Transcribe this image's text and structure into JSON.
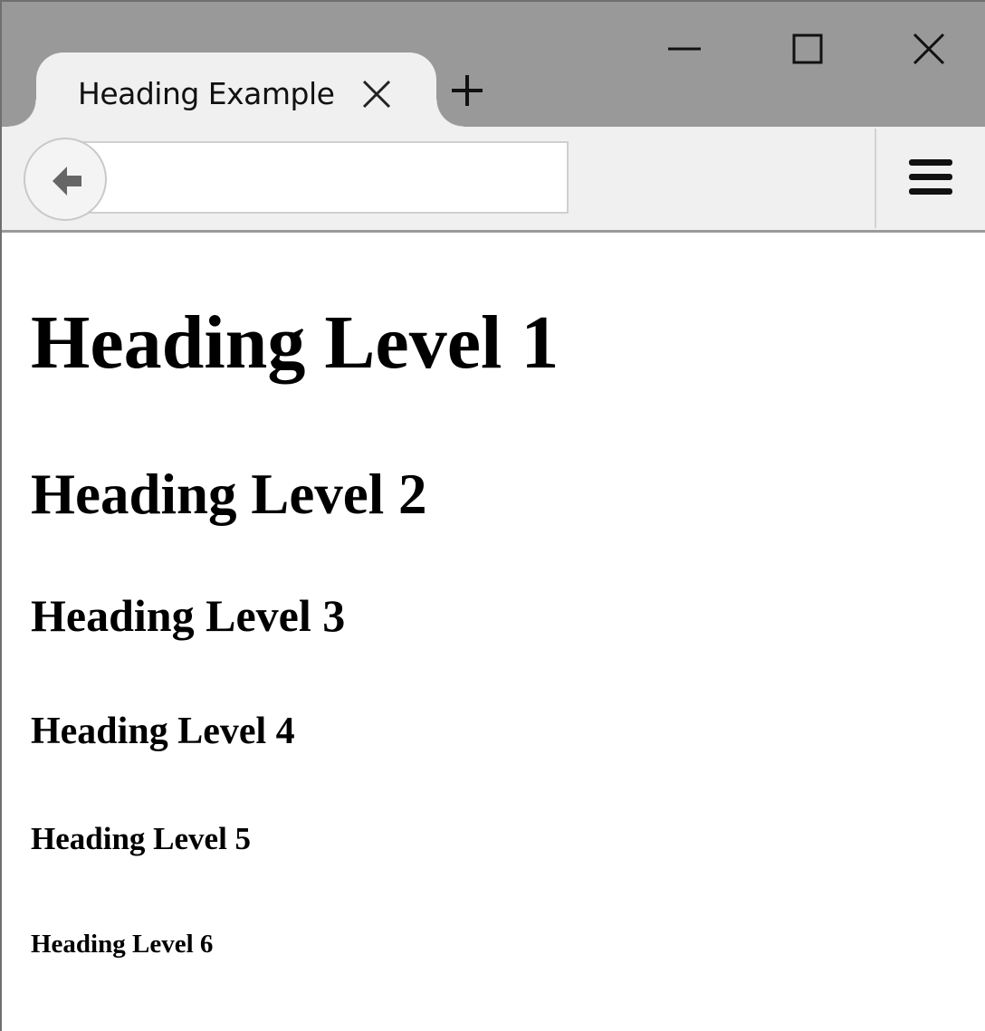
{
  "browser": {
    "tab": {
      "title": "Heading Example",
      "close_icon": "close-icon"
    },
    "new_tab_icon": "plus-icon",
    "window_controls": {
      "minimize_icon": "minimize-icon",
      "maximize_icon": "maximize-icon",
      "close_icon": "close-icon"
    },
    "toolbar": {
      "back_icon": "arrow-left-icon",
      "url_value": "",
      "menu_icon": "hamburger-menu-icon"
    }
  },
  "page": {
    "headings": {
      "h1": "Heading Level 1",
      "h2": "Heading Level 2",
      "h3": "Heading Level 3",
      "h4": "Heading Level 4",
      "h5": "Heading Level 5",
      "h6": "Heading Level 6"
    }
  },
  "colors": {
    "titlebar": "#999999",
    "toolbar": "#f0f0f0",
    "content_background": "#ffffff",
    "text": "#000000"
  }
}
